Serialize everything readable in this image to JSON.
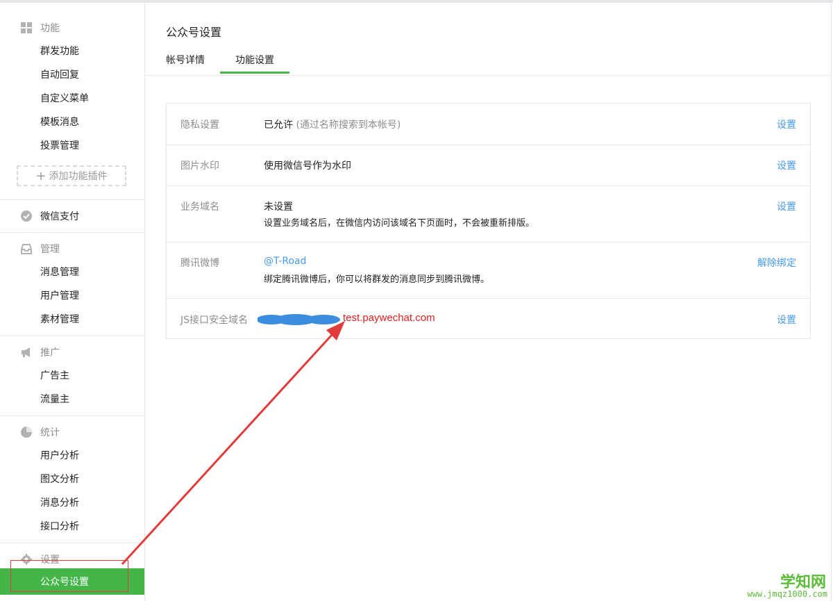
{
  "sidebar": {
    "groups": [
      {
        "title": "功能",
        "icon": "grid-icon",
        "items": [
          "群发功能",
          "自动回复",
          "自定义菜单",
          "模板消息",
          "投票管理"
        ]
      },
      {
        "title": "微信支付",
        "icon": "wechat-pay-icon",
        "items": []
      },
      {
        "title": "管理",
        "icon": "inbox-icon",
        "items": [
          "消息管理",
          "用户管理",
          "素材管理"
        ]
      },
      {
        "title": "推广",
        "icon": "megaphone-icon",
        "items": [
          "广告主",
          "流量主"
        ]
      },
      {
        "title": "统计",
        "icon": "pie-chart-icon",
        "items": [
          "用户分析",
          "图文分析",
          "消息分析",
          "接口分析"
        ]
      },
      {
        "title": "设置",
        "icon": "gear-icon",
        "items": [
          "公众号设置"
        ]
      }
    ],
    "add_plugin_label": "添加功能插件",
    "active_item": "公众号设置"
  },
  "main": {
    "title": "公众号设置",
    "tabs": [
      {
        "label": "帐号详情",
        "active": false
      },
      {
        "label": "功能设置",
        "active": true
      }
    ],
    "settings": [
      {
        "label": "隐私设置",
        "value": "已允许",
        "hint": "(通过名称搜索到本帐号)",
        "action": "设置"
      },
      {
        "label": "图片水印",
        "value": "使用微信号作为水印",
        "action": "设置"
      },
      {
        "label": "业务域名",
        "value": "未设置",
        "description": "设置业务域名后，在微信内访问该域名下页面时，不会被重新排版。",
        "action": "设置"
      },
      {
        "label": "腾讯微博",
        "value": "@T-Road",
        "description": "绑定腾讯微博后，你可以将群发的消息同步到腾讯微博。",
        "action": "解除绑定"
      },
      {
        "label": "JS接口安全域名",
        "value": "test.paywechat.com",
        "action": "设置"
      }
    ]
  },
  "watermark": {
    "title": "学知网",
    "url": "www.jmqz1000.com"
  },
  "colors": {
    "accent": "#44b549",
    "link": "#459ae9",
    "annotation": "#e02020",
    "blur": "#3b8de0"
  }
}
